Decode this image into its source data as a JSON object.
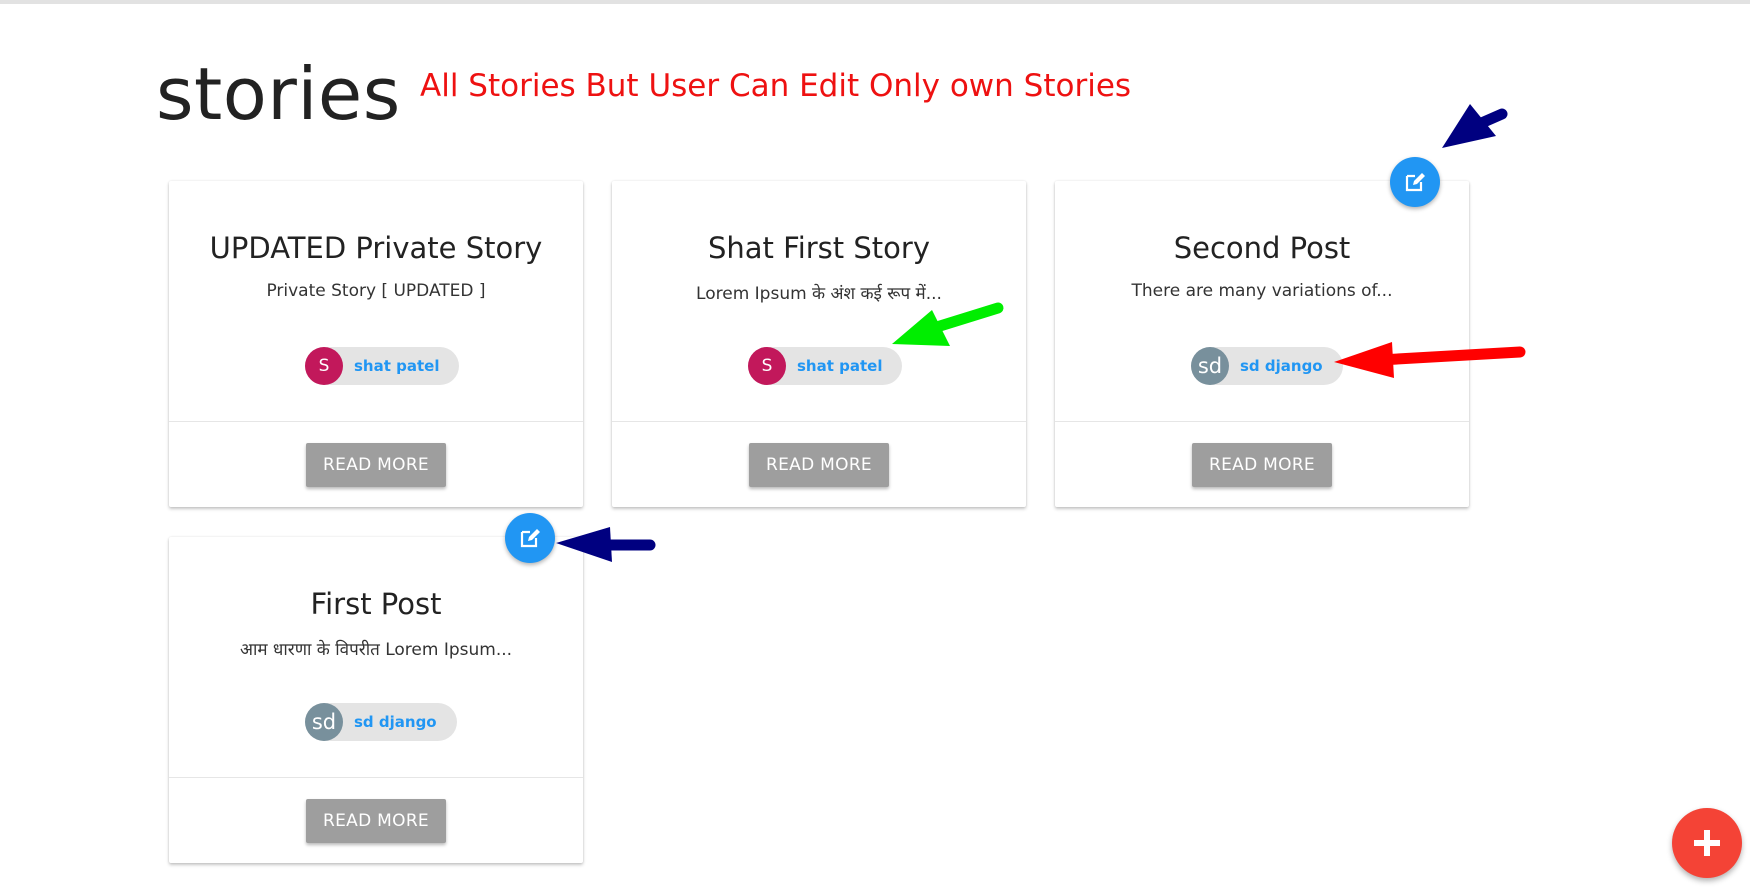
{
  "page": {
    "title": "stories",
    "annotation": "All Stories But User Can Edit Only own Stories"
  },
  "stories": [
    {
      "title": "UPDATED Private Story",
      "excerpt": "Private Story [ UPDATED ]",
      "author_initials": "S",
      "author_name": "shat patel",
      "read_more_label": "READ MORE"
    },
    {
      "title": "Shat First Story",
      "excerpt": "Lorem Ipsum के अंश कई रूप में...",
      "author_initials": "S",
      "author_name": "shat patel",
      "read_more_label": "READ MORE"
    },
    {
      "title": "Second Post",
      "excerpt": "There are many variations of...",
      "author_initials": "sd",
      "author_name": "sd django",
      "read_more_label": "READ MORE",
      "editable": true
    },
    {
      "title": "First Post",
      "excerpt": "आम धारणा के विपरीत Lorem Ipsum...",
      "author_initials": "sd",
      "author_name": "sd django",
      "read_more_label": "READ MORE",
      "editable": true
    }
  ],
  "icons": {
    "edit": "edit-icon",
    "add": "plus-icon"
  },
  "colors": {
    "annotation_text": "#ee1111",
    "edit_button": "#2196f3",
    "add_button": "#f44336",
    "read_more_button": "#9e9e9e",
    "author_link": "#2196f3",
    "avatar_s": "#c2185b",
    "avatar_sd": "#78909c",
    "arrow_navy": "#000080",
    "arrow_green": "#00ee00",
    "arrow_red": "#ff0000"
  }
}
